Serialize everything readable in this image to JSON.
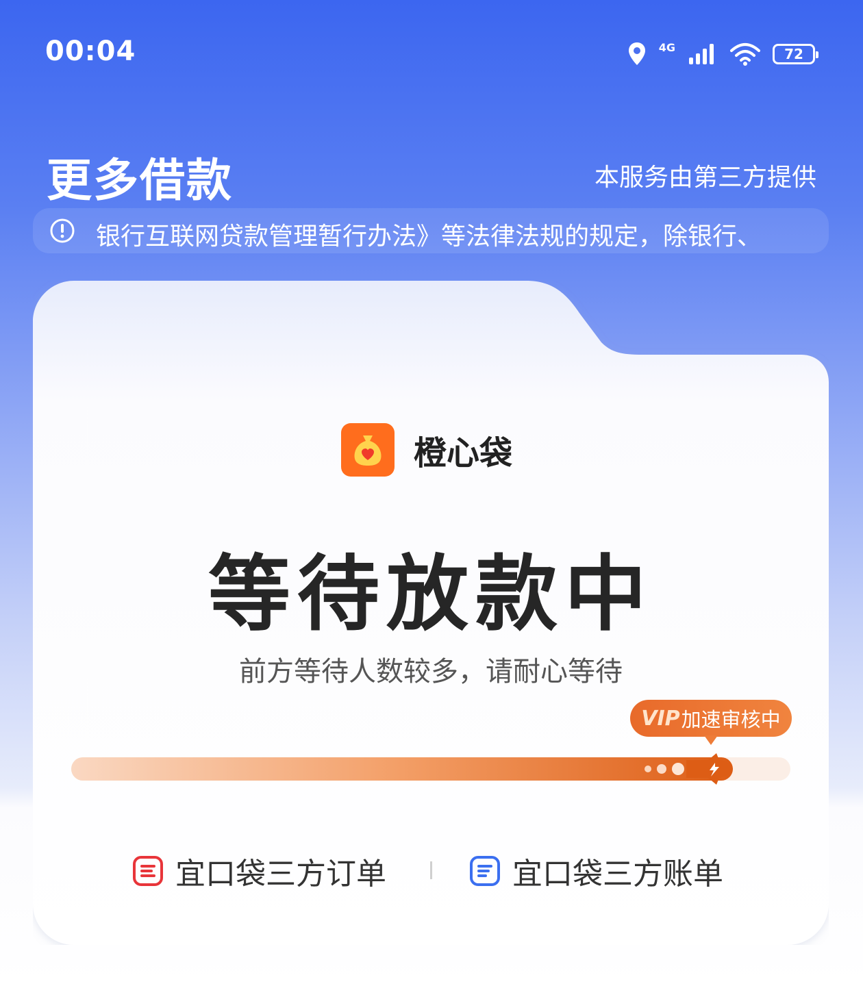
{
  "status_bar": {
    "time": "00:04",
    "network": "4G",
    "battery": "72",
    "icons": [
      "location-icon",
      "signal-icon",
      "wifi-icon",
      "battery-icon"
    ]
  },
  "header": {
    "title": "更多借款",
    "note": "本服务由第三方提供"
  },
  "notice": {
    "icon": "info-circle-icon",
    "text": "银行互联网贷款管理暂行办法》等法律法规的规定，除银行、"
  },
  "card": {
    "brand_name": "橙心袋",
    "brand_logo": "money-bag-heart-icon",
    "status_title": "等待放款中",
    "status_subtitle": "前方等待人数较多，请耐心等待",
    "vip_tag": "VIP",
    "vip_text": "加速审核中",
    "progress_fraction": 0.92,
    "links": [
      {
        "label": "宜口袋三方订单",
        "icon": "order-doc-icon",
        "color": "#e8353a"
      },
      {
        "label": "宜口袋三方账单",
        "icon": "bill-doc-icon",
        "color": "#3b6ff0"
      }
    ]
  },
  "colors": {
    "brand_blue": "#3c66f0",
    "accent_orange": "#ff6d1d",
    "progress_orange": "#dd5d15"
  }
}
